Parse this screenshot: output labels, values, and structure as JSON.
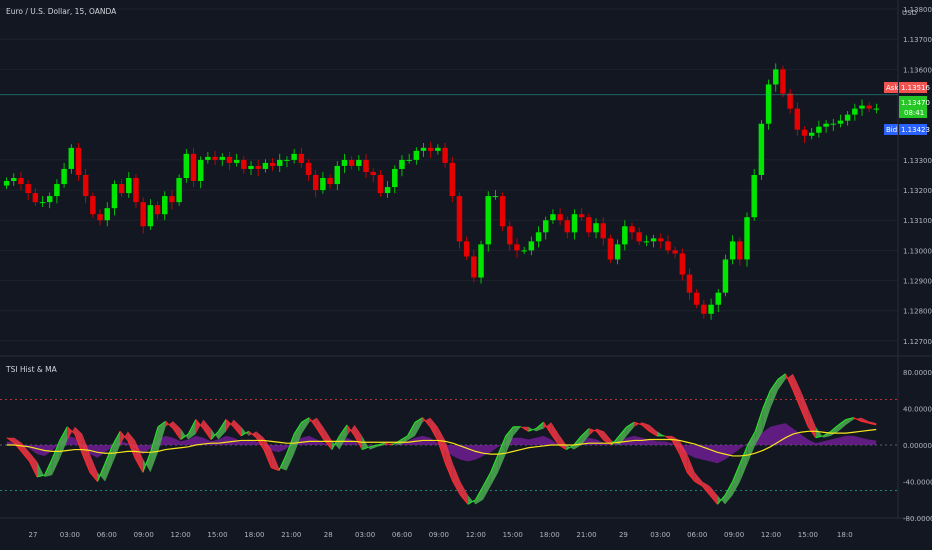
{
  "header": {
    "symbol_title": "Euro / U.S. Dollar, 15, OANDA",
    "currency": "USD"
  },
  "price_axis": {
    "ticks": [
      "1.13800",
      "1.13700",
      "1.13600",
      "1.13300",
      "1.13200",
      "1.13100",
      "1.13000",
      "1.12900",
      "1.12800",
      "1.12700"
    ]
  },
  "price_badges": {
    "ask_label": "Ask",
    "ask_value": "1.13516",
    "last_value": "1.13470",
    "countdown": "08:41",
    "bid_label": "Bid",
    "bid_value": "1.13423"
  },
  "indicator": {
    "title": "TSI Hist & MA",
    "ticks": [
      "80.00000",
      "40.00000",
      "0.00000",
      "-40.00000",
      "-80.00000"
    ],
    "upper_level": 50,
    "lower_level": -50
  },
  "time_axis": {
    "labels": [
      "27",
      "03:00",
      "06:00",
      "09:00",
      "12:00",
      "15:00",
      "18:00",
      "21:00",
      "28",
      "03:00",
      "06:00",
      "09:00",
      "12:00",
      "15:00",
      "18:00",
      "21:00",
      "29",
      "03:00",
      "06:00",
      "09:00",
      "12:00",
      "15:00",
      "18:0"
    ]
  },
  "colors": {
    "background": "#131722",
    "up": "#00e600",
    "down": "#e60000",
    "tsi_up": "#4caf50",
    "tsi_down": "#f23645",
    "hist": "#7b1fa2",
    "ma": "#f7e51c",
    "ask_badge": "#f05350",
    "last_badge": "#26c626",
    "bid_badge": "#2962ff"
  },
  "chart_data": [
    {
      "type": "candlestick",
      "title": "Euro / U.S. Dollar, 15, OANDA",
      "ylim": [
        1.1265,
        1.1383
      ],
      "close": [
        1.1323,
        1.1324,
        1.1322,
        1.1319,
        1.1316,
        1.1316,
        1.1318,
        1.1322,
        1.1327,
        1.1334,
        1.1325,
        1.1318,
        1.1312,
        1.131,
        1.1314,
        1.1322,
        1.1319,
        1.1324,
        1.1316,
        1.1308,
        1.1315,
        1.1312,
        1.1318,
        1.1316,
        1.1324,
        1.1332,
        1.1323,
        1.133,
        1.1331,
        1.133,
        1.1331,
        1.1329,
        1.133,
        1.1327,
        1.1328,
        1.1327,
        1.1329,
        1.1328,
        1.133,
        1.133,
        1.1332,
        1.1329,
        1.1325,
        1.132,
        1.1324,
        1.1322,
        1.1328,
        1.133,
        1.1328,
        1.133,
        1.1326,
        1.1325,
        1.1319,
        1.1321,
        1.1327,
        1.133,
        1.133,
        1.1333,
        1.1334,
        1.1333,
        1.1334,
        1.1329,
        1.1318,
        1.1303,
        1.1298,
        1.1291,
        1.1302,
        1.1318,
        1.1318,
        1.1308,
        1.1302,
        1.13,
        1.13,
        1.1303,
        1.1306,
        1.131,
        1.1312,
        1.131,
        1.1306,
        1.1312,
        1.1311,
        1.1306,
        1.1309,
        1.1304,
        1.1297,
        1.1302,
        1.1308,
        1.1306,
        1.1303,
        1.1303,
        1.1304,
        1.1303,
        1.13,
        1.1299,
        1.1292,
        1.1286,
        1.1282,
        1.1279,
        1.1282,
        1.1286,
        1.1297,
        1.1303,
        1.1297,
        1.1311,
        1.1325,
        1.1342,
        1.1355,
        1.136,
        1.1352,
        1.1347,
        1.134,
        1.1338,
        1.1339,
        1.1341,
        1.1342,
        1.1342,
        1.1343,
        1.1345,
        1.1347,
        1.1348,
        1.1347,
        1.1347
      ]
    },
    {
      "type": "line",
      "title": "TSI Hist & MA",
      "ylim": [
        -80,
        80
      ],
      "series": [
        {
          "values": [
            8,
            2,
            -8,
            -18,
            -35,
            -33,
            -15,
            5,
            20,
            12,
            -10,
            -30,
            -40,
            -20,
            0,
            15,
            5,
            -15,
            -30,
            -8,
            20,
            26,
            18,
            6,
            12,
            28,
            18,
            6,
            15,
            28,
            20,
            10,
            15,
            8,
            -5,
            -25,
            -28,
            -10,
            12,
            25,
            30,
            18,
            5,
            -5,
            10,
            22,
            10,
            -5,
            -2,
            0,
            2,
            0,
            5,
            10,
            25,
            30,
            20,
            5,
            -20,
            -40,
            -55,
            -65,
            -60,
            -45,
            -30,
            -10,
            10,
            20,
            20,
            15,
            18,
            25,
            12,
            0,
            -5,
            0,
            10,
            18,
            15,
            5,
            0,
            10,
            20,
            25,
            22,
            15,
            10,
            10,
            5,
            -10,
            -30,
            -40,
            -45,
            -55,
            -65,
            -55,
            -40,
            -20,
            0,
            15,
            40,
            60,
            72,
            78,
            60,
            40,
            20,
            8,
            10,
            15,
            22,
            28,
            30,
            26,
            24,
            22
          ]
        },
        {
          "values": [
            0,
            0,
            -1,
            -2,
            -4,
            -6,
            -7,
            -7,
            -6,
            -5,
            -5,
            -6,
            -8,
            -9,
            -9,
            -8,
            -7,
            -7,
            -8,
            -8,
            -7,
            -5,
            -4,
            -3,
            -2,
            0,
            1,
            2,
            2,
            3,
            4,
            5,
            5,
            5,
            5,
            4,
            3,
            2,
            2,
            3,
            4,
            4,
            4,
            4,
            4,
            4,
            4,
            3,
            3,
            3,
            3,
            3,
            3,
            3,
            4,
            5,
            5,
            5,
            4,
            2,
            -1,
            -4,
            -7,
            -9,
            -10,
            -10,
            -9,
            -7,
            -5,
            -3,
            -2,
            -1,
            0,
            0,
            0,
            0,
            1,
            2,
            2,
            2,
            2,
            3,
            4,
            5,
            5,
            6,
            6,
            6,
            6,
            5,
            3,
            1,
            -2,
            -5,
            -8,
            -10,
            -12,
            -12,
            -11,
            -9,
            -6,
            -2,
            3,
            8,
            12,
            14,
            15,
            15,
            14,
            13,
            13,
            13,
            14,
            15,
            16,
            17
          ]
        },
        {
          "values": [
            4,
            2,
            0,
            -4,
            -10,
            -12,
            -6,
            2,
            10,
            8,
            -2,
            -10,
            -14,
            -8,
            -2,
            4,
            2,
            -4,
            -10,
            -4,
            6,
            10,
            8,
            4,
            6,
            10,
            8,
            4,
            6,
            10,
            8,
            4,
            6,
            4,
            0,
            -6,
            -8,
            -4,
            4,
            8,
            10,
            6,
            2,
            -2,
            4,
            8,
            4,
            -2,
            -1,
            0,
            1,
            0,
            2,
            4,
            8,
            10,
            8,
            2,
            -6,
            -12,
            -16,
            -18,
            -16,
            -12,
            -8,
            -2,
            4,
            8,
            8,
            6,
            8,
            10,
            6,
            0,
            -2,
            0,
            4,
            8,
            6,
            2,
            0,
            4,
            8,
            10,
            8,
            6,
            4,
            4,
            2,
            -4,
            -10,
            -14,
            -16,
            -18,
            -20,
            -16,
            -10,
            -4,
            2,
            8,
            14,
            20,
            22,
            24,
            18,
            12,
            6,
            2,
            4,
            6,
            8,
            10,
            10,
            8,
            6,
            5
          ]
        }
      ]
    }
  ]
}
